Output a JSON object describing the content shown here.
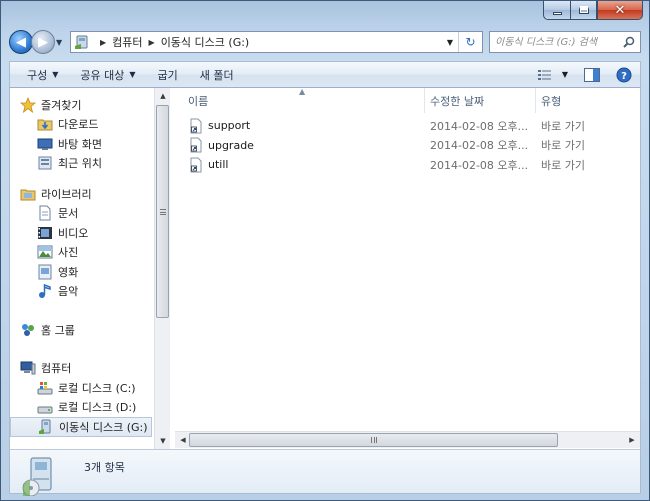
{
  "window": {
    "controls": {
      "minimize": "minimize",
      "maximize": "maximize",
      "close": "close"
    }
  },
  "address": {
    "crumbs": [
      "컴퓨터",
      "이동식 디스크 (G:)"
    ]
  },
  "search": {
    "placeholder": "이동식 디스크 (G:) 검색"
  },
  "toolbar": {
    "organize": "구성",
    "share": "공유 대상",
    "burn": "굽기",
    "new_folder": "새 폴더"
  },
  "nav": {
    "favorites": {
      "label": "즐겨찾기",
      "items": [
        {
          "label": "다운로드",
          "icon": "download-folder-icon"
        },
        {
          "label": "바탕 화면",
          "icon": "desktop-icon"
        },
        {
          "label": "최근 위치",
          "icon": "recent-places-icon"
        }
      ]
    },
    "libraries": {
      "label": "라이브러리",
      "items": [
        {
          "label": "문서",
          "icon": "documents-icon"
        },
        {
          "label": "비디오",
          "icon": "videos-icon"
        },
        {
          "label": "사진",
          "icon": "pictures-icon"
        },
        {
          "label": "영화",
          "icon": "movies-icon"
        },
        {
          "label": "음악",
          "icon": "music-icon"
        }
      ]
    },
    "homegroup": {
      "label": "홈 그룹"
    },
    "computer": {
      "label": "컴퓨터",
      "items": [
        {
          "label": "로컬 디스크 (C:)",
          "icon": "local-disk-icon"
        },
        {
          "label": "로컬 디스크 (D:)",
          "icon": "local-disk-icon"
        },
        {
          "label": "이동식 디스크 (G:)",
          "icon": "removable-disk-icon",
          "selected": true
        }
      ]
    }
  },
  "columns": {
    "name": "이름",
    "date": "수정한 날짜",
    "type": "유형"
  },
  "files": [
    {
      "name": "support",
      "date": "2014-02-08 오후...",
      "type": "바로 가기"
    },
    {
      "name": "upgrade",
      "date": "2014-02-08 오후...",
      "type": "바로 가기"
    },
    {
      "name": "utill",
      "date": "2014-02-08 오후...",
      "type": "바로 가기"
    }
  ],
  "status": {
    "count": "3개 항목"
  }
}
